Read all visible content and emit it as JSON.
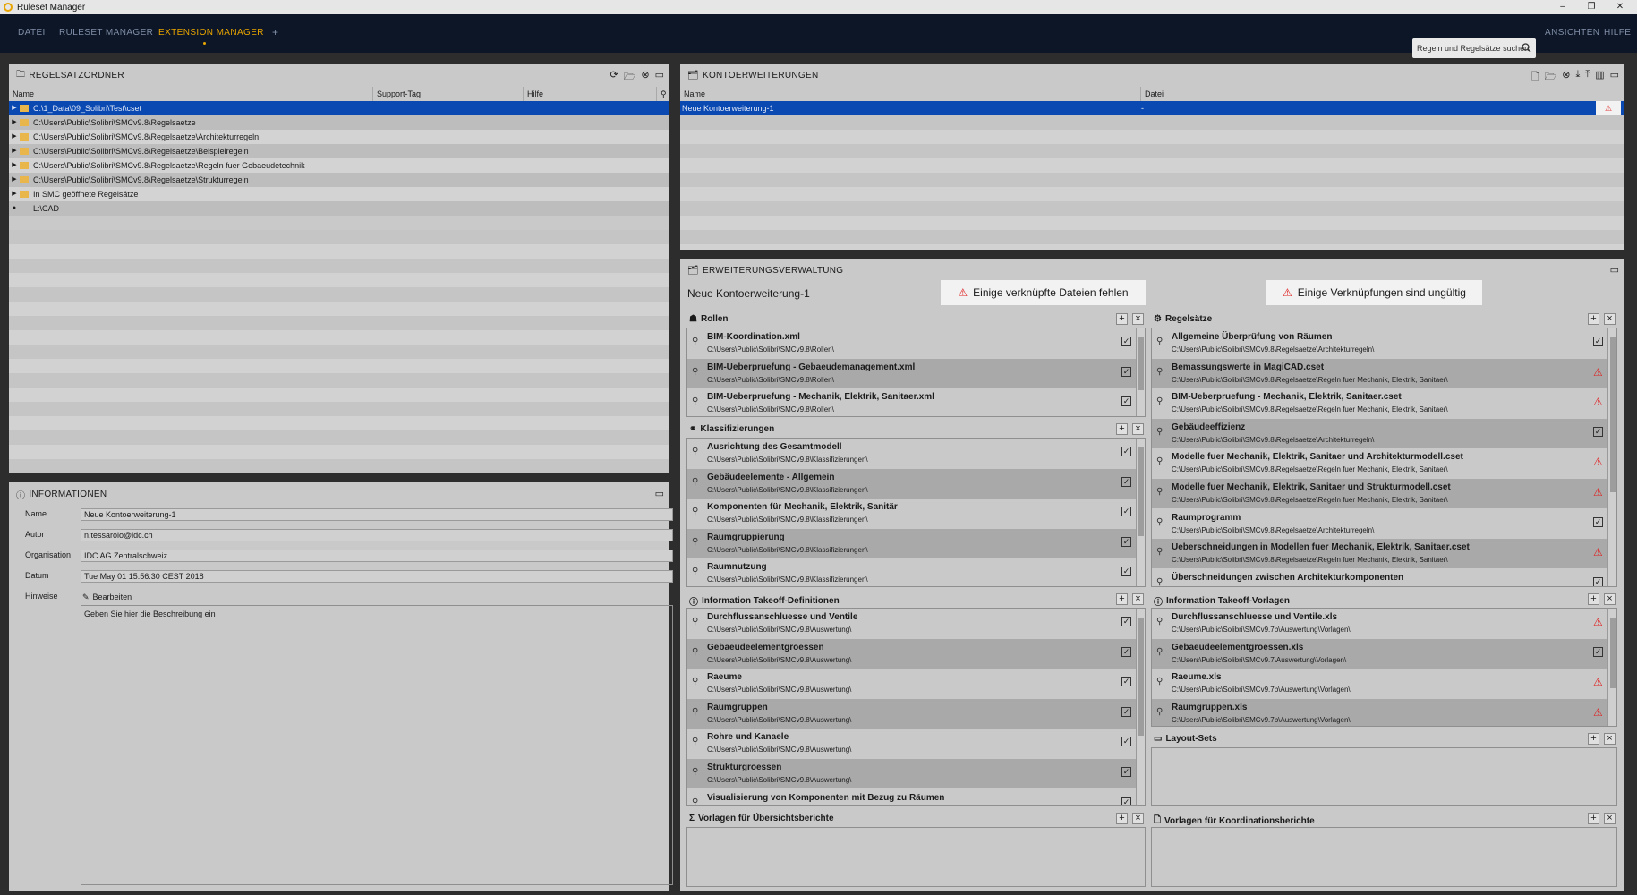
{
  "window": {
    "title": "Ruleset Manager",
    "controls": [
      "–",
      "❐",
      "✕"
    ]
  },
  "menu": {
    "items": [
      "DATEI",
      "RULESET MANAGER",
      "EXTENSION MANAGER",
      "+"
    ],
    "active": "EXTENSION MANAGER",
    "search_placeholder": "Regeln und Regelsätze suchen",
    "right": [
      "ANSICHTEN",
      "HILFE"
    ]
  },
  "colors": {
    "accent": "#e8a400",
    "selection": "#0a49b2",
    "warning": "#e02020",
    "menubar": "#0d1626"
  },
  "regelsatzordner": {
    "title": "REGELSATZORDNER",
    "columns": [
      "Name",
      "Support-Tag",
      "Hilfe"
    ],
    "rows": [
      "C:\\1_Data\\09_Solibri\\Test\\cset",
      "C:\\Users\\Public\\Solibri\\SMCv9.8\\Regelsaetze",
      "C:\\Users\\Public\\Solibri\\SMCv9.8\\Regelsaetze\\Architekturregeln",
      "C:\\Users\\Public\\Solibri\\SMCv9.8\\Regelsaetze\\Beispielregeln",
      "C:\\Users\\Public\\Solibri\\SMCv9.8\\Regelsaetze\\Regeln fuer Gebaeudetechnik",
      "C:\\Users\\Public\\Solibri\\SMCv9.8\\Regelsaetze\\Strukturregeln",
      "In SMC geöffnete Regelsätze",
      "L:\\CAD"
    ]
  },
  "informationen": {
    "title": "INFORMATIONEN",
    "labels": {
      "name": "Name",
      "autor": "Autor",
      "organisation": "Organisation",
      "datum": "Datum",
      "hinweise": "Hinweise"
    },
    "values": {
      "name": "Neue Kontoerweiterung-1",
      "autor": "n.tessarolo@idc.ch",
      "organisation": "IDC AG Zentralschweiz",
      "datum": "Tue May 01 15:56:30 CEST 2018"
    },
    "edit_label": "Bearbeiten",
    "description": "Geben Sie hier die Beschreibung ein"
  },
  "kontoerweiterungen": {
    "title": "KONTOERWEITERUNGEN",
    "columns": [
      "Name",
      "Datei"
    ],
    "rows": [
      {
        "name": "Neue Kontoerweiterung-1",
        "datei": "-"
      }
    ]
  },
  "verwaltung": {
    "title": "ERWEITERUNGSVERWALTUNG",
    "name": "Neue Kontoerweiterung-1",
    "warn1": "Einige verknüpfte Dateien fehlen",
    "warn2": "Einige Verknüpfungen sind ungültig"
  },
  "rollen": {
    "title": "Rollen",
    "items": [
      {
        "t": "BIM-Koordination.xml",
        "p": "C:\\Users\\Public\\Solibri\\SMCv9.8\\Rollen\\",
        "s": "ok"
      },
      {
        "t": "BIM-Ueberpruefung - Gebaeudemanagement.xml",
        "p": "C:\\Users\\Public\\Solibri\\SMCv9.8\\Rollen\\",
        "s": "ok"
      },
      {
        "t": "BIM-Ueberpruefung - Mechanik, Elektrik, Sanitaer.xml",
        "p": "C:\\Users\\Public\\Solibri\\SMCv9.8\\Rollen\\",
        "s": "ok"
      }
    ]
  },
  "klassifizierungen": {
    "title": "Klassifizierungen",
    "items": [
      {
        "t": "Ausrichtung des Gesamtmodell",
        "p": "C:\\Users\\Public\\Solibri\\SMCv9.8\\Klassifizierungen\\",
        "s": "ok"
      },
      {
        "t": "Gebäudeelemente - Allgemein",
        "p": "C:\\Users\\Public\\Solibri\\SMCv9.8\\Klassifizierungen\\",
        "s": "ok"
      },
      {
        "t": "Komponenten für Mechanik, Elektrik, Sanitär",
        "p": "C:\\Users\\Public\\Solibri\\SMCv9.8\\Klassifizierungen\\",
        "s": "ok"
      },
      {
        "t": "Raumgruppierung",
        "p": "C:\\Users\\Public\\Solibri\\SMCv9.8\\Klassifizierungen\\",
        "s": "ok"
      },
      {
        "t": "Raumnutzung",
        "p": "C:\\Users\\Public\\Solibri\\SMCv9.8\\Klassifizierungen\\",
        "s": "ok"
      }
    ]
  },
  "ito_def": {
    "title": "Information Takeoff-Definitionen",
    "items": [
      {
        "t": "Durchflussanschluesse und Ventile",
        "p": "C:\\Users\\Public\\Solibri\\SMCv9.8\\Auswertung\\",
        "s": "ok"
      },
      {
        "t": "Gebaeudeelementgroessen",
        "p": "C:\\Users\\Public\\Solibri\\SMCv9.8\\Auswertung\\",
        "s": "ok"
      },
      {
        "t": "Raeume",
        "p": "C:\\Users\\Public\\Solibri\\SMCv9.8\\Auswertung\\",
        "s": "ok"
      },
      {
        "t": "Raumgruppen",
        "p": "C:\\Users\\Public\\Solibri\\SMCv9.8\\Auswertung\\",
        "s": "ok"
      },
      {
        "t": "Rohre und Kanaele",
        "p": "C:\\Users\\Public\\Solibri\\SMCv9.8\\Auswertung\\",
        "s": "ok"
      },
      {
        "t": "Strukturgroessen",
        "p": "C:\\Users\\Public\\Solibri\\SMCv9.8\\Auswertung\\",
        "s": "ok"
      },
      {
        "t": "Visualisierung von Komponenten mit Bezug zu Räumen",
        "p": "",
        "s": "ok"
      }
    ]
  },
  "vorlagen_ueb": {
    "title": "Vorlagen für Übersichtsberichte"
  },
  "regelsaetze": {
    "title": "Regelsätze",
    "items": [
      {
        "t": "Allgemeine Überprüfung von Räumen",
        "p": "C:\\Users\\Public\\Solibri\\SMCv9.8\\Regelsaetze\\Architekturregeln\\",
        "s": "ok"
      },
      {
        "t": "Bemassungswerte in MagiCAD.cset",
        "p": "C:\\Users\\Public\\Solibri\\SMCv9.8\\Regelsaetze\\Regeln fuer Mechanik, Elektrik, Sanitaer\\",
        "s": "warn"
      },
      {
        "t": "BIM-Ueberpruefung - Mechanik, Elektrik, Sanitaer.cset",
        "p": "C:\\Users\\Public\\Solibri\\SMCv9.8\\Regelsaetze\\Regeln fuer Mechanik, Elektrik, Sanitaer\\",
        "s": "warn"
      },
      {
        "t": "Gebäudeeffizienz",
        "p": "C:\\Users\\Public\\Solibri\\SMCv9.8\\Regelsaetze\\Architekturregeln\\",
        "s": "ok"
      },
      {
        "t": "Modelle fuer Mechanik, Elektrik, Sanitaer und Architekturmodell.cset",
        "p": "C:\\Users\\Public\\Solibri\\SMCv9.8\\Regelsaetze\\Regeln fuer Mechanik, Elektrik, Sanitaer\\",
        "s": "warn"
      },
      {
        "t": "Modelle fuer Mechanik, Elektrik, Sanitaer und Strukturmodell.cset",
        "p": "C:\\Users\\Public\\Solibri\\SMCv9.8\\Regelsaetze\\Regeln fuer Mechanik, Elektrik, Sanitaer\\",
        "s": "warn"
      },
      {
        "t": "Raumprogramm",
        "p": "C:\\Users\\Public\\Solibri\\SMCv9.8\\Regelsaetze\\Architekturregeln\\",
        "s": "ok"
      },
      {
        "t": "Ueberschneidungen in Modellen fuer Mechanik, Elektrik, Sanitaer.cset",
        "p": "C:\\Users\\Public\\Solibri\\SMCv9.8\\Regelsaetze\\Regeln fuer Mechanik, Elektrik, Sanitaer\\",
        "s": "warn"
      },
      {
        "t": "Überschneidungen zwischen Architekturkomponenten",
        "p": "",
        "s": "ok"
      }
    ]
  },
  "ito_vorl": {
    "title": "Information Takeoff-Vorlagen",
    "items": [
      {
        "t": "Durchflussanschluesse und Ventile.xls",
        "p": "C:\\Users\\Public\\Solibri\\SMCv9.7b\\Auswertung\\Vorlagen\\",
        "s": "warn"
      },
      {
        "t": "Gebaeudeelementgroessen.xls",
        "p": "C:\\Users\\Public\\Solibri\\SMCv9.7\\Auswertung\\Vorlagen\\",
        "s": "ok"
      },
      {
        "t": "Raeume.xls",
        "p": "C:\\Users\\Public\\Solibri\\SMCv9.7b\\Auswertung\\Vorlagen\\",
        "s": "warn"
      },
      {
        "t": "Raumgruppen.xls",
        "p": "C:\\Users\\Public\\Solibri\\SMCv9.7b\\Auswertung\\Vorlagen\\",
        "s": "warn"
      }
    ]
  },
  "layout_sets": {
    "title": "Layout-Sets"
  },
  "vorlagen_koord": {
    "title": "Vorlagen für Koordinationsberichte"
  }
}
